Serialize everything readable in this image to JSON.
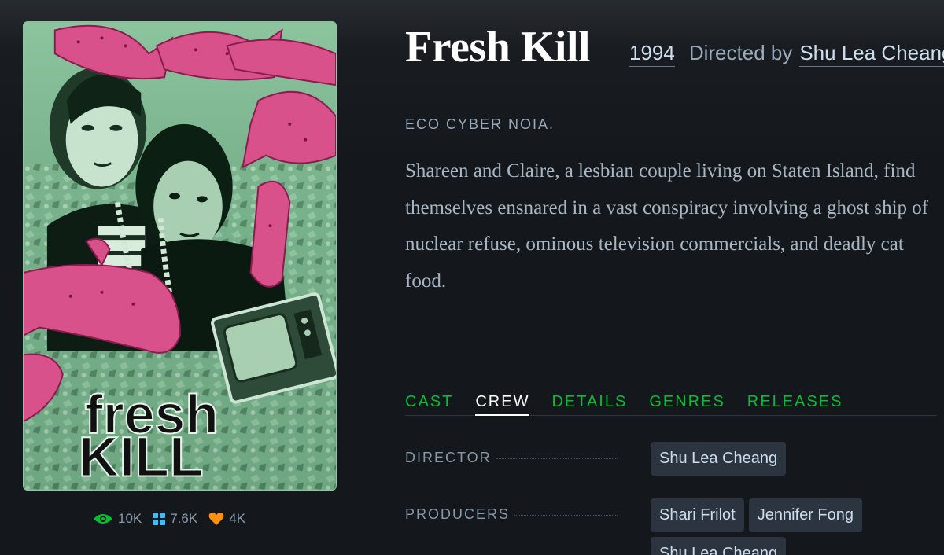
{
  "film": {
    "title": "Fresh Kill",
    "year": "1994",
    "directed_prefix": "Directed by",
    "director": "Shu Lea Cheang",
    "tagline": "ECO CYBER NOIA.",
    "synopsis": "Shareen and Claire, a lesbian couple living on Staten Island, find themselves ensnared in a vast conspiracy involving a ghost ship of nuclear refuse, ominous television commercials, and deadly cat food."
  },
  "poster": {
    "logo_line1": "fresh",
    "logo_line2": "KILL"
  },
  "stats": {
    "watched": "10K",
    "lists": "7.6K",
    "likes": "4K"
  },
  "tabs": [
    {
      "label": "CAST",
      "active": false
    },
    {
      "label": "CREW",
      "active": true
    },
    {
      "label": "DETAILS",
      "active": false
    },
    {
      "label": "GENRES",
      "active": false
    },
    {
      "label": "RELEASES",
      "active": false
    }
  ],
  "crew": [
    {
      "role": "DIRECTOR",
      "people": [
        "Shu Lea Cheang"
      ]
    },
    {
      "role": "PRODUCERS",
      "people": [
        "Shari Frilot",
        "Jennifer Fong",
        "Shu Lea Cheang"
      ]
    }
  ],
  "icons": {
    "watched": "eye-icon",
    "lists": "grid-icon",
    "likes": "heart-icon"
  },
  "colors": {
    "background": "#14181c",
    "accent_green": "#00c030",
    "watched_icon": "#00c030",
    "lists_icon": "#40bcf4",
    "likes_icon": "#ff9010",
    "chip_bg": "#2c3440"
  }
}
